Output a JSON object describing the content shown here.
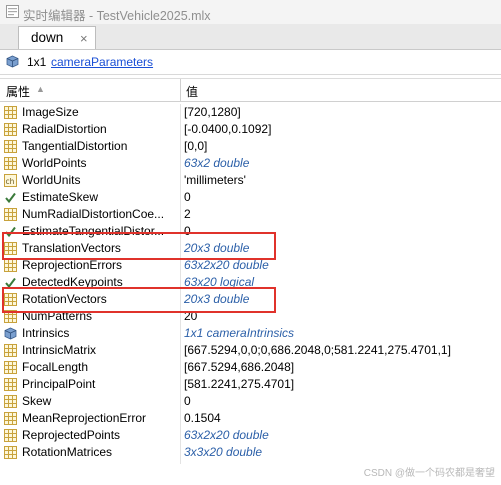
{
  "window": {
    "title": "实时编辑器 - TestVehicle2025.mlx"
  },
  "tabs": [
    {
      "label": "down",
      "close": "×"
    }
  ],
  "info": {
    "size": "1x1",
    "class_link": "cameraParameters"
  },
  "headers": {
    "name": "属性",
    "value": "值"
  },
  "rows": [
    {
      "name": "ImageSize",
      "value": "[720,1280]",
      "icon": "table-icon",
      "meta": false
    },
    {
      "name": "RadialDistortion",
      "value": "[-0.0400,0.1092]",
      "icon": "table-icon",
      "meta": false
    },
    {
      "name": "TangentialDistortion",
      "value": "[0,0]",
      "icon": "table-icon",
      "meta": false
    },
    {
      "name": "WorldPoints",
      "value": "63x2 double",
      "icon": "table-icon",
      "meta": true
    },
    {
      "name": "WorldUnits",
      "value": "'millimeters'",
      "icon": "char-icon",
      "meta": false
    },
    {
      "name": "EstimateSkew",
      "value": "0",
      "icon": "checkbox-icon",
      "meta": false
    },
    {
      "name": "NumRadialDistortionCoe...",
      "value": "2",
      "icon": "table-icon",
      "meta": false
    },
    {
      "name": "EstimateTangentialDistor...",
      "value": "0",
      "icon": "checkbox-icon",
      "meta": false
    },
    {
      "name": "TranslationVectors",
      "value": "20x3 double",
      "icon": "table-icon",
      "meta": true
    },
    {
      "name": "ReprojectionErrors",
      "value": "63x2x20 double",
      "icon": "table-icon",
      "meta": true
    },
    {
      "name": "DetectedKeypoints",
      "value": "63x20 logical",
      "icon": "checkbox-icon",
      "meta": true
    },
    {
      "name": "RotationVectors",
      "value": "20x3 double",
      "icon": "table-icon",
      "meta": true
    },
    {
      "name": "NumPatterns",
      "value": "20",
      "icon": "table-icon",
      "meta": false
    },
    {
      "name": "Intrinsics",
      "value": "1x1 cameraIntrinsics",
      "icon": "object-icon",
      "meta": true
    },
    {
      "name": "IntrinsicMatrix",
      "value": "[667.5294,0,0;0,686.2048,0;581.2241,275.4701,1]",
      "icon": "table-icon",
      "meta": false
    },
    {
      "name": "FocalLength",
      "value": "[667.5294,686.2048]",
      "icon": "table-icon",
      "meta": false
    },
    {
      "name": "PrincipalPoint",
      "value": "[581.2241,275.4701]",
      "icon": "table-icon",
      "meta": false
    },
    {
      "name": "Skew",
      "value": "0",
      "icon": "table-icon",
      "meta": false
    },
    {
      "name": "MeanReprojectionError",
      "value": "0.1504",
      "icon": "table-icon",
      "meta": false
    },
    {
      "name": "ReprojectedPoints",
      "value": "63x2x20 double",
      "icon": "table-icon",
      "meta": true
    },
    {
      "name": "RotationMatrices",
      "value": "3x3x20 double",
      "icon": "table-icon",
      "meta": true
    }
  ],
  "watermark": "CSDN @做一个码农都是奢望",
  "colors": {
    "highlight": "#e0322b",
    "link": "#1a4fd6",
    "meta_value": "#2b5fa8"
  }
}
